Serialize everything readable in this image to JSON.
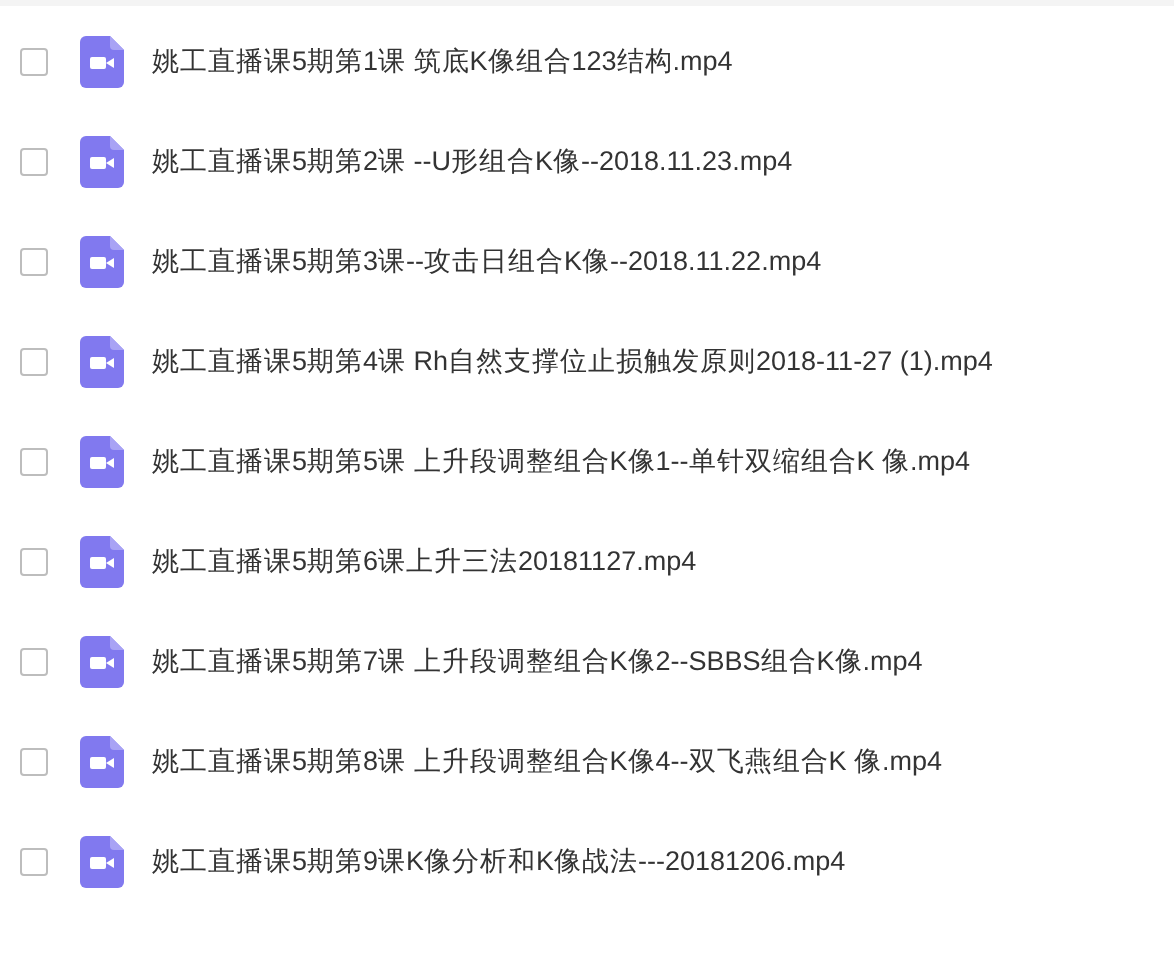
{
  "files": [
    {
      "name": "姚工直播课5期第1课 筑底K像组合123结构.mp4",
      "checked": false
    },
    {
      "name": "姚工直播课5期第2课 --U形组合K像--2018.11.23.mp4",
      "checked": false
    },
    {
      "name": "姚工直播课5期第3课--攻击日组合K像--2018.11.22.mp4",
      "checked": false
    },
    {
      "name": "姚工直播课5期第4课 Rh自然支撑位止损触发原则2018-11-27 (1).mp4",
      "checked": false
    },
    {
      "name": "姚工直播课5期第5课 上升段调整组合K像1--单针双缩组合K 像.mp4",
      "checked": false
    },
    {
      "name": "姚工直播课5期第6课上升三法20181127.mp4",
      "checked": false
    },
    {
      "name": "姚工直播课5期第7课 上升段调整组合K像2--SBBS组合K像.mp4",
      "checked": false
    },
    {
      "name": "姚工直播课5期第8课 上升段调整组合K像4--双飞燕组合K 像.mp4",
      "checked": false
    },
    {
      "name": "姚工直播课5期第9课K像分析和K像战法---20181206.mp4",
      "checked": false
    }
  ]
}
